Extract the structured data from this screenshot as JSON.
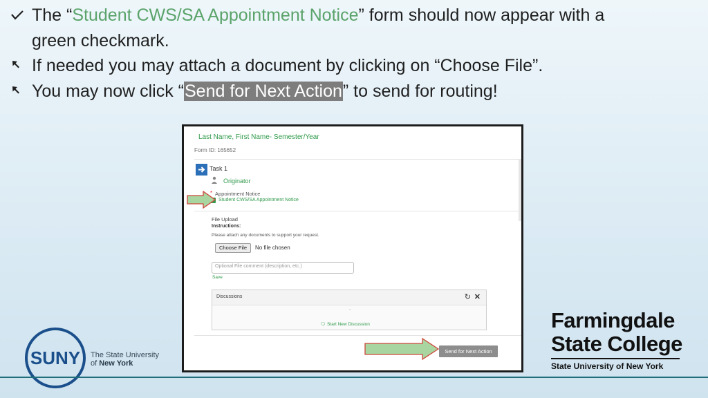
{
  "bullets": [
    {
      "marker": "checkmark",
      "pre": "The “",
      "highlight": "Student CWS/SA  Appointment Notice",
      "post_line1": "” form should now appear with a",
      "line2": "green checkmark."
    },
    {
      "marker": "arrow",
      "text": "If needed you may attach a document by clicking on “Choose File”."
    },
    {
      "marker": "arrow",
      "pre": "You may now click “",
      "highlight": "Send for Next Action",
      "post": "” to send for routing!"
    }
  ],
  "screenshot": {
    "name_line": "Last Name, First Name- Semester/Year",
    "form_id": "Form ID: 165652",
    "task": "Task 1",
    "originator": "Originator",
    "appointment_label": "Appointment Notice",
    "appointment_link": "Student CWS/SA Appointment Notice",
    "file_upload": "File Upload",
    "instructions": "Instructions:",
    "attach_text": "Please attach any documents to support your request.",
    "choose_file": "Choose File",
    "no_file": "No file chosen",
    "comment_placeholder": "Optional File comment (description, etc.)",
    "save": "Save",
    "discussions": "Discussions",
    "start_discussion": "Start New Discussion",
    "send_button": "Send for Next Action"
  },
  "logos": {
    "suny_mark": "SUNY",
    "suny_line1": "The State University",
    "suny_line2_pre": "of ",
    "suny_line2_bold": "New York",
    "fsc_line1": "Farmingdale",
    "fsc_line2": "State College",
    "fsc_line3": "State University of New York"
  },
  "colors": {
    "accent_green": "#5aa36a",
    "highlight_grey": "#7d7d7d",
    "arrow_fill": "#a9d6a0",
    "arrow_stroke": "#d0463c",
    "suny_blue": "#1a4f8b"
  }
}
